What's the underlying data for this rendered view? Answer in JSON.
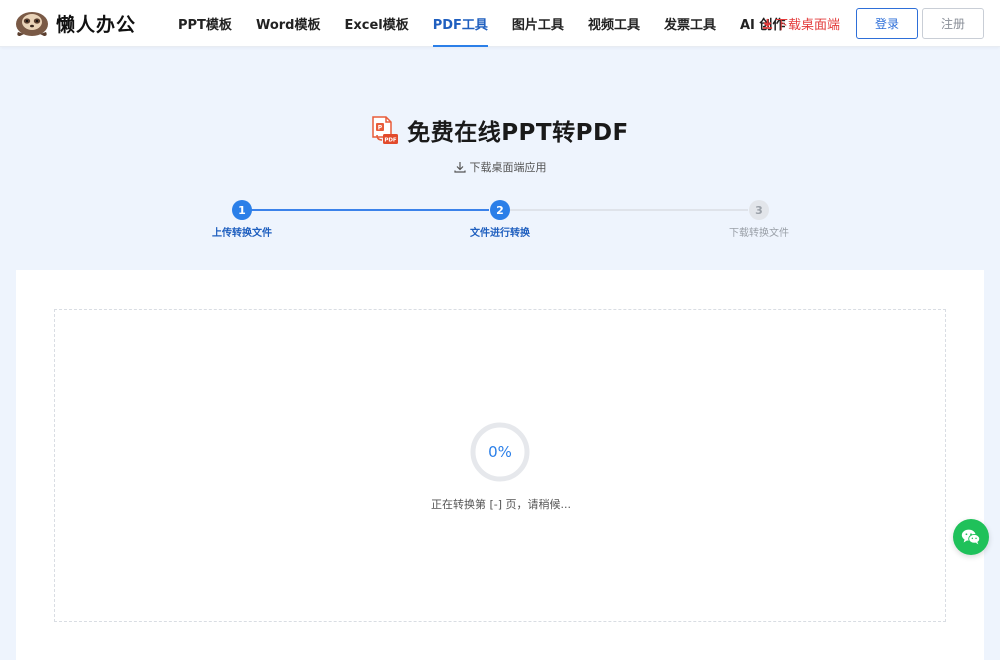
{
  "header": {
    "logo_text": "懒人办公",
    "nav": [
      {
        "label": "PPT模板",
        "active": false
      },
      {
        "label": "Word模板",
        "active": false
      },
      {
        "label": "Excel模板",
        "active": false
      },
      {
        "label": "PDF工具",
        "active": true
      },
      {
        "label": "图片工具",
        "active": false
      },
      {
        "label": "视频工具",
        "active": false
      },
      {
        "label": "发票工具",
        "active": false
      },
      {
        "label": "AI 创作",
        "active": false
      }
    ],
    "download_link": "下载桌面端",
    "login": "登录",
    "register": "注册"
  },
  "page": {
    "title": "免费在线PPT转PDF",
    "sub_download": "下载桌面端应用"
  },
  "steps": [
    {
      "number": "1",
      "label": "上传转换文件",
      "state": "done"
    },
    {
      "number": "2",
      "label": "文件进行转换",
      "state": "active"
    },
    {
      "number": "3",
      "label": "下载转换文件",
      "state": "pending"
    }
  ],
  "conversion": {
    "progress_text": "0%",
    "progress_value": 0,
    "status_text": "正在转换第 [-] 页，请稍候..."
  },
  "colors": {
    "accent": "#2b7fe8",
    "download_red": "#e33b3b",
    "wechat_green": "#1fc15a",
    "page_bg": "#eef4fd"
  },
  "icons": [
    "sloth-logo-icon",
    "download-icon",
    "ppt-to-pdf-icon",
    "wechat-icon"
  ]
}
